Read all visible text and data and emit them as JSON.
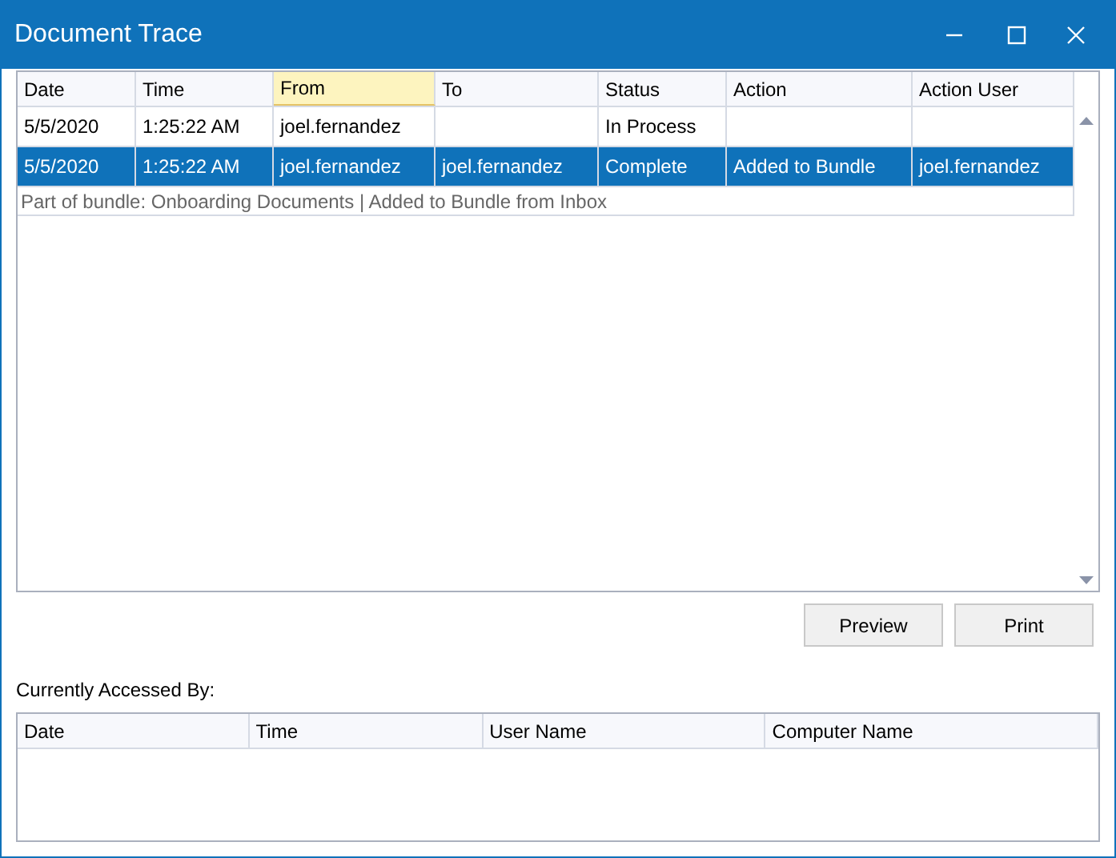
{
  "window": {
    "title": "Document Trace"
  },
  "trace_table": {
    "columns": [
      {
        "label": "Date",
        "highlighted": false
      },
      {
        "label": "Time",
        "highlighted": false
      },
      {
        "label": "From",
        "highlighted": true
      },
      {
        "label": "To",
        "highlighted": false
      },
      {
        "label": "Status",
        "highlighted": false
      },
      {
        "label": "Action",
        "highlighted": false
      },
      {
        "label": "Action User",
        "highlighted": false
      }
    ],
    "rows": [
      {
        "selected": false,
        "cells": [
          "5/5/2020",
          "1:25:22 AM",
          "joel.fernandez",
          "",
          "In Process",
          "",
          ""
        ]
      },
      {
        "selected": true,
        "cells": [
          "5/5/2020",
          "1:25:22 AM",
          "joel.fernandez",
          "joel.fernandez",
          "Complete",
          "Added to Bundle",
          "joel.fernandez"
        ],
        "detail": "Part of bundle: Onboarding Documents | Added to Bundle from Inbox"
      }
    ]
  },
  "buttons": [
    "Preview",
    "Print"
  ],
  "accessed_label": "Currently Accessed By:",
  "access_table": {
    "columns": [
      "Date",
      "Time",
      "User Name",
      "Computer Name"
    ]
  }
}
